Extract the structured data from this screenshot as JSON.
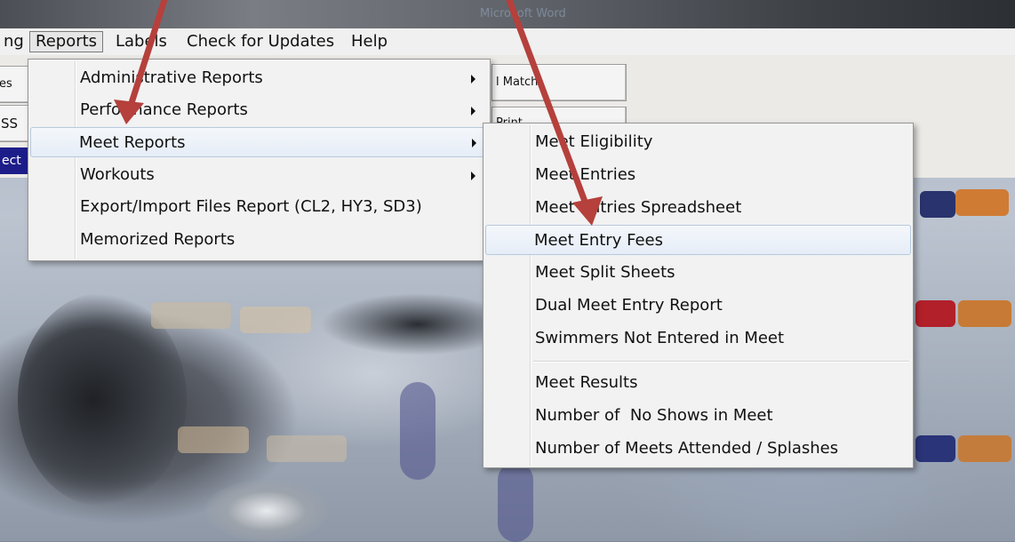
{
  "window": {
    "title": "Microsoft Word"
  },
  "menubar": {
    "items": [
      {
        "label": "ng"
      },
      {
        "label": "Reports"
      },
      {
        "label": "Labels"
      },
      {
        "label": "Check for Updates"
      },
      {
        "label": "Help"
      }
    ]
  },
  "toolbar": {
    "buttons": [
      {
        "label": "es"
      },
      {
        "label": "l Match"
      },
      {
        "label": "SS"
      },
      {
        "label": "Print"
      }
    ],
    "selected_strip": "ect"
  },
  "reports_menu": {
    "items": [
      {
        "label": "Administrative Reports",
        "submenu": true
      },
      {
        "label": "Performance Reports",
        "submenu": true
      },
      {
        "label": "Meet Reports",
        "submenu": true
      },
      {
        "label": "Workouts",
        "submenu": true
      },
      {
        "label": "Export/Import Files Report (CL2, HY3, SD3)",
        "submenu": false
      },
      {
        "label": "Memorized Reports",
        "submenu": false
      }
    ]
  },
  "meet_reports_menu": {
    "items": [
      {
        "label": "Meet Eligibility"
      },
      {
        "label": "Meet Entries"
      },
      {
        "label": "Meet Entries Spreadsheet"
      },
      {
        "label": "Meet Entry Fees"
      },
      {
        "label": "Meet Split Sheets"
      },
      {
        "label": "Dual Meet Entry Report"
      },
      {
        "label": "Swimmers Not Entered in Meet"
      },
      {
        "label": "Meet Results"
      },
      {
        "label": "Number of  No Shows in Meet"
      },
      {
        "label": "Number of Meets Attended / Splashes"
      }
    ]
  },
  "colors": {
    "annotation_arrow": "#b5403c",
    "menu_highlight_border": "#b8c9de",
    "selected_strip": "#1d1d8a"
  }
}
